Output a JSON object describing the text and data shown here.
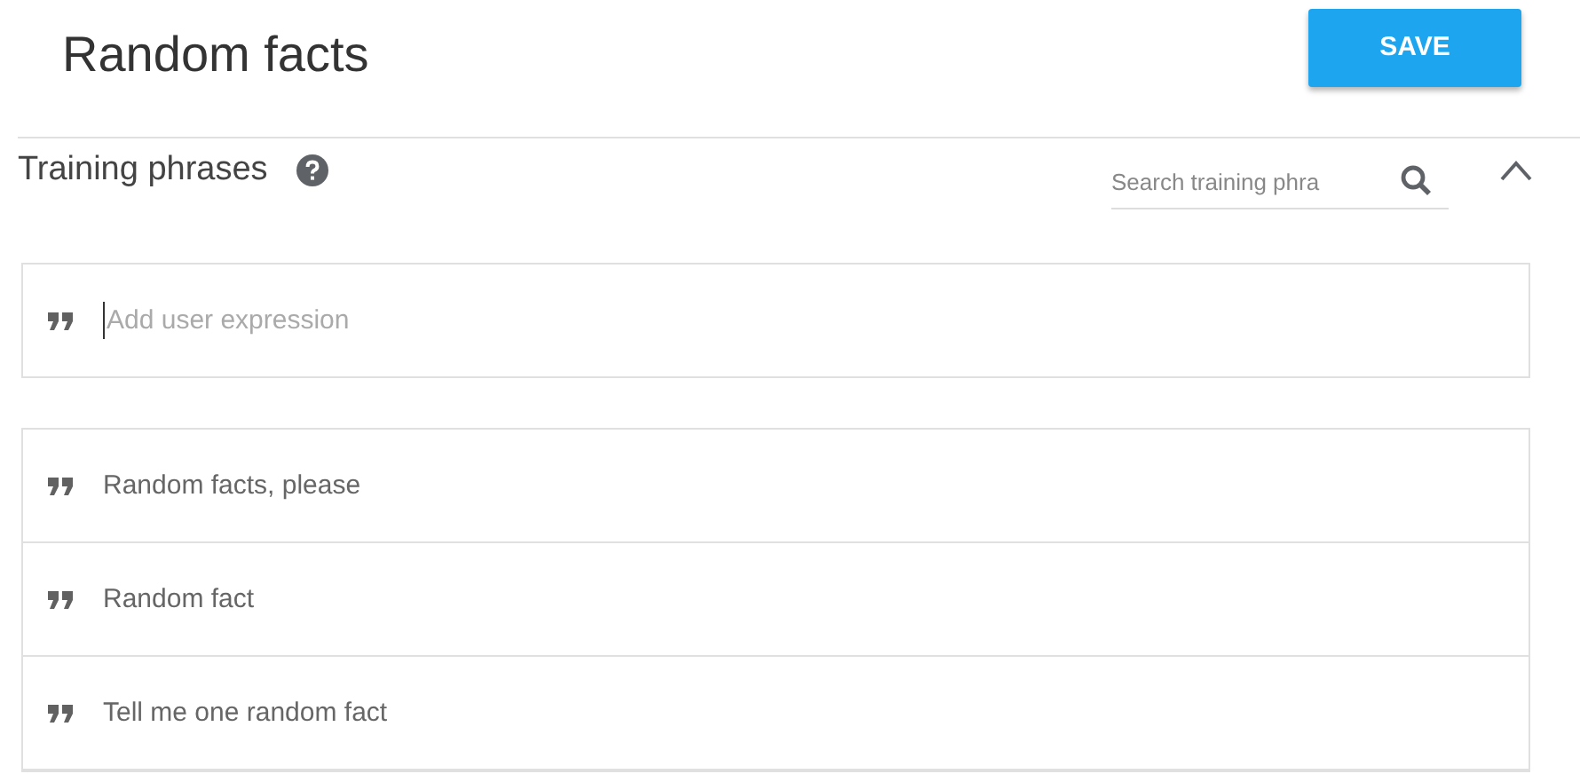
{
  "title": "Random facts",
  "save_button": "SAVE",
  "section": {
    "title": "Training phrases",
    "expanded": true
  },
  "search": {
    "placeholder": "Search training phra"
  },
  "new_phrase": {
    "placeholder": "Add user expression"
  },
  "phrases": [
    {
      "text": "Random facts, please"
    },
    {
      "text": "Random fact"
    },
    {
      "text": "Tell me one random fact"
    }
  ]
}
